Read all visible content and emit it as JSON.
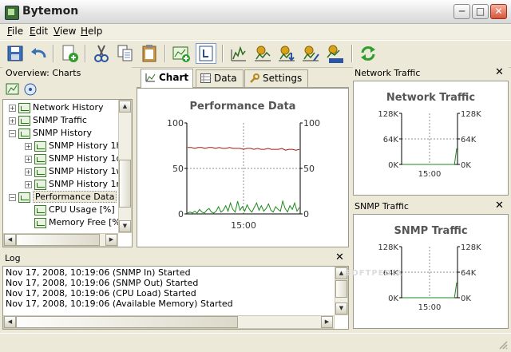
{
  "window": {
    "title": "Bytemon"
  },
  "menu": [
    {
      "label": "File",
      "u": "F",
      "rest": "ile"
    },
    {
      "label": "Edit",
      "u": "E",
      "rest": "dit"
    },
    {
      "label": "View",
      "u": "V",
      "rest": "iew"
    },
    {
      "label": "Help",
      "u": "H",
      "rest": "elp"
    }
  ],
  "overview": {
    "title": "Overview: Charts"
  },
  "tree": [
    {
      "label": "Network History",
      "indent": 0,
      "expander": "+"
    },
    {
      "label": "SNMP Traffic",
      "indent": 0,
      "expander": "+"
    },
    {
      "label": "SNMP History",
      "indent": 0,
      "expander": "-"
    },
    {
      "label": "SNMP History 1h",
      "indent": 1,
      "expander": "+"
    },
    {
      "label": "SNMP History 1d",
      "indent": 1,
      "expander": "+"
    },
    {
      "label": "SNMP History 1w",
      "indent": 1,
      "expander": "+"
    },
    {
      "label": "SNMP History 1m",
      "indent": 1,
      "expander": "+"
    },
    {
      "label": "Performance Data",
      "indent": 0,
      "expander": "-",
      "selected": true
    },
    {
      "label": "CPU Usage [%]",
      "indent": 1,
      "expander": ""
    },
    {
      "label": "Memory Free [%]",
      "indent": 1,
      "expander": ""
    }
  ],
  "tabs": [
    {
      "label": "Chart",
      "active": true
    },
    {
      "label": "Data"
    },
    {
      "label": "Settings"
    }
  ],
  "log": {
    "title": "Log",
    "lines": [
      "Nov 17, 2008, 10:19:06 (SNMP In) Started",
      "Nov 17, 2008, 10:19:06 (SNMP Out) Started",
      "Nov 17, 2008, 10:19:06 (CPU Load) Started",
      "Nov 17, 2008, 10:19:06 (Available Memory) Started"
    ]
  },
  "panes": {
    "network": {
      "header": "Network Traffic"
    },
    "snmp": {
      "header": "SNMP Traffic"
    }
  },
  "watermark": "SOFTPEDIA",
  "colors": {
    "series_red": "#a21818",
    "series_green": "#1d8a1d",
    "chrome": "#ece9d8"
  },
  "chart_data": [
    {
      "id": "performance",
      "type": "line",
      "title": "Performance Data",
      "ylim": [
        0,
        100
      ],
      "y_ticks": [
        0,
        50,
        100
      ],
      "right_y_ticks": [
        0,
        50,
        100
      ],
      "x_ticks": [
        "15:00"
      ],
      "grid": true,
      "series": [
        {
          "color": "#a21818",
          "values": [
            73,
            73,
            72,
            73,
            73,
            72,
            73,
            73,
            72,
            73,
            72,
            72,
            73,
            72,
            72,
            72,
            71,
            72,
            72,
            71,
            72,
            71,
            71,
            72,
            71,
            71,
            71,
            72,
            70,
            71,
            71,
            70,
            71
          ]
        },
        {
          "color": "#1d8a1d",
          "values": [
            1,
            2,
            1,
            3,
            1,
            5,
            2,
            1,
            4,
            6,
            2,
            1,
            3,
            8,
            2,
            4,
            9,
            3,
            12,
            5,
            2,
            14,
            4,
            8,
            3,
            10,
            5,
            2,
            7,
            12,
            4,
            9,
            3,
            6,
            11,
            4,
            2,
            8,
            5,
            3,
            14,
            6,
            2,
            9,
            5,
            12,
            3,
            7
          ]
        }
      ]
    },
    {
      "id": "network",
      "type": "line",
      "title": "Network Traffic",
      "ylim": [
        0,
        128
      ],
      "y_ticks": [
        "0K",
        "64K",
        "128K"
      ],
      "right_y_ticks": [
        "0K",
        "64K",
        "128K"
      ],
      "x_ticks": [
        "15:00"
      ],
      "grid": true,
      "series": [
        {
          "color": "#1d8a1d",
          "values": [
            0,
            0,
            0,
            0,
            0,
            0,
            0,
            0,
            0,
            0,
            0,
            0,
            0,
            0,
            0,
            0,
            0,
            0,
            0,
            0,
            0,
            0,
            0,
            0,
            40
          ]
        }
      ]
    },
    {
      "id": "snmp",
      "type": "line",
      "title": "SNMP Traffic",
      "ylim": [
        0,
        128
      ],
      "y_ticks": [
        "0K",
        "64K",
        "128K"
      ],
      "right_y_ticks": [
        "0K",
        "64K",
        "128K"
      ],
      "x_ticks": [
        "15:00"
      ],
      "grid": true,
      "series": [
        {
          "color": "#1d8a1d",
          "values": [
            0,
            0,
            0,
            0,
            0,
            0,
            0,
            0,
            0,
            0,
            0,
            0,
            0,
            0,
            0,
            0,
            0,
            0,
            0,
            0,
            0,
            0,
            0,
            0,
            38
          ]
        }
      ]
    }
  ]
}
